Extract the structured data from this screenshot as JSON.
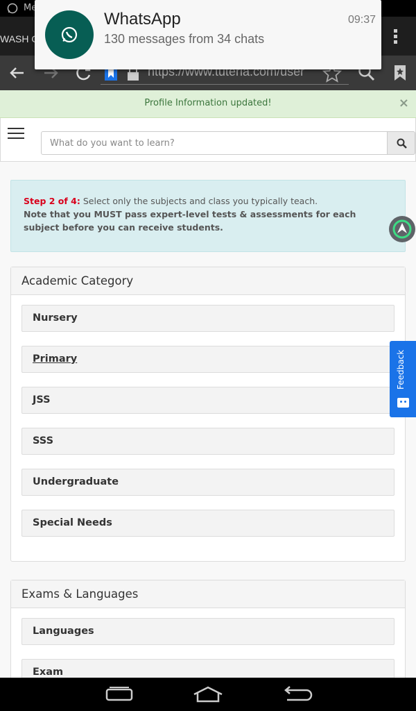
{
  "status_bar": {
    "notification_app_short": "Me",
    "icons": [
      "whatsapp-icon"
    ]
  },
  "notification": {
    "app_name": "WhatsApp",
    "message": "130 messages from 34 chats",
    "time": "09:37",
    "icon": "whatsapp-icon",
    "brand_color": "#075e54"
  },
  "browser": {
    "tab_title": "WASH C",
    "url": "https://www.tuteria.com/user",
    "toolbar_icons": [
      "back-icon",
      "forward-icon",
      "reload-icon",
      "bookmark-icon",
      "lock-icon",
      "star-icon",
      "search-icon",
      "bookmarks-icon",
      "overflow-menu-icon"
    ]
  },
  "alert": {
    "message": "Profile Information updated!",
    "close_label": "×"
  },
  "header": {
    "search_placeholder": "What do you want to learn?"
  },
  "info": {
    "step_label": "Step 2 of 4:",
    "step_text": " Select only the subjects and class you typically teach.",
    "note": "Note that you MUST pass expert-level tests & assessments for each subject before you can receive students."
  },
  "academic": {
    "title": "Academic Category",
    "items": [
      "Nursery",
      "Primary",
      "JSS",
      "SSS",
      "Undergraduate",
      "Special Needs"
    ]
  },
  "exams": {
    "title": "Exams & Languages",
    "items": [
      "Languages",
      "Exam"
    ]
  },
  "feedback": {
    "label": "Feedback",
    "color": "#1a73e8"
  },
  "nav": {
    "icons": [
      "recent-apps-icon",
      "home-icon",
      "back-icon"
    ]
  }
}
